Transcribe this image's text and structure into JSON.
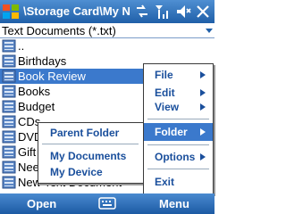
{
  "titlebar": {
    "title": "\\Storage Card\\My No",
    "icons": [
      "windows-logo",
      "sync-icon",
      "signal-icon",
      "volume-icon",
      "close-icon"
    ]
  },
  "filter": {
    "label": "Text Documents (*.txt)"
  },
  "files": [
    {
      "name": "..",
      "type": "folder-up"
    },
    {
      "name": "Birthdays",
      "type": "folder"
    },
    {
      "name": "Book Review",
      "type": "folder",
      "selected": true
    },
    {
      "name": "Books",
      "type": "folder"
    },
    {
      "name": "Budget",
      "type": "folder"
    },
    {
      "name": "CDs",
      "type": "folder"
    },
    {
      "name": "DVD",
      "type": "folder"
    },
    {
      "name": "Gift",
      "type": "folder"
    },
    {
      "name": "Nee",
      "type": "folder"
    },
    {
      "name": "New Text Document",
      "type": "folder"
    }
  ],
  "menu": {
    "items": [
      {
        "label": "File",
        "submenu": true
      },
      {
        "label": "Edit",
        "submenu": true
      },
      {
        "label": "View",
        "submenu": true
      },
      {
        "label": "Folder",
        "submenu": true,
        "selected": true
      },
      {
        "label": "Options",
        "submenu": true
      },
      {
        "label": "Exit",
        "submenu": false
      }
    ],
    "folder_submenu": [
      "Parent Folder",
      "My Documents",
      "My Device"
    ]
  },
  "softkeys": {
    "left": "Open",
    "right": "Menu"
  },
  "colors": {
    "accent": "#3b79cc",
    "menu_text": "#1a4f9c",
    "bar": "#1f5fa8"
  }
}
